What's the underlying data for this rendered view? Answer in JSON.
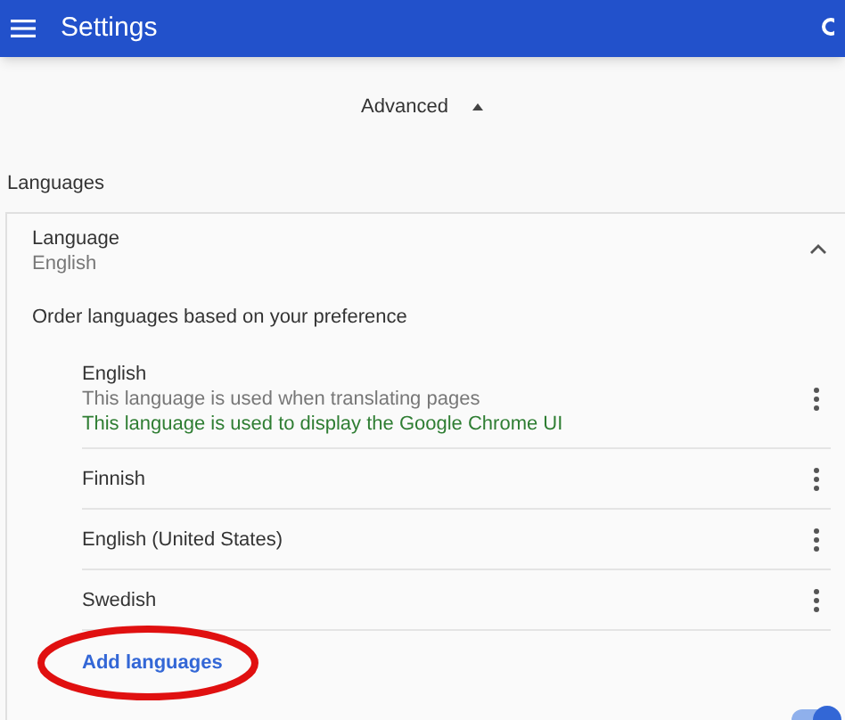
{
  "header": {
    "title": "Settings"
  },
  "advanced": {
    "label": "Advanced",
    "expanded": true
  },
  "section_title": "Languages",
  "language": {
    "label": "Language",
    "value": "English",
    "expanded": true,
    "order_hint": "Order languages based on your preference",
    "items": [
      {
        "name": "English",
        "notes": [
          {
            "text": "This language is used when translating pages",
            "kind": "plain"
          },
          {
            "text": "This language is used to display the Google Chrome UI",
            "kind": "highlight"
          }
        ]
      },
      {
        "name": "Finnish"
      },
      {
        "name": "English (United States)"
      },
      {
        "name": "Swedish"
      }
    ],
    "add_link": "Add languages"
  },
  "translate_toggle": {
    "on": true
  }
}
